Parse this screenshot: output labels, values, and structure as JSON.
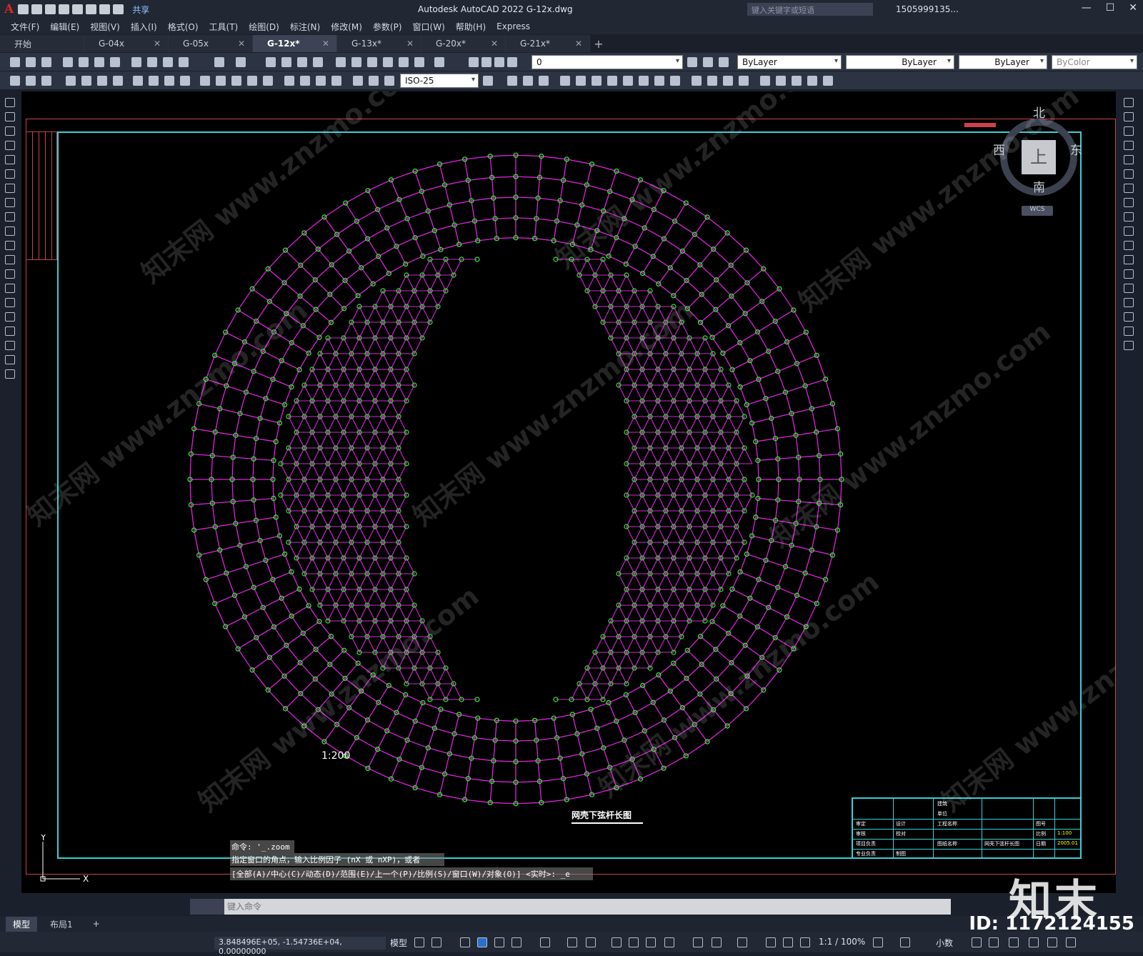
{
  "app": {
    "logo": "A",
    "share_label": "共享",
    "title": "Autodesk AutoCAD 2022    G-12x.dwg",
    "search_placeholder": "键入关键字或短语",
    "user": "1505999135...",
    "window_controls": [
      "—",
      "☐",
      "✕"
    ]
  },
  "menu": [
    "文件(F)",
    "编辑(E)",
    "视图(V)",
    "插入(I)",
    "格式(O)",
    "工具(T)",
    "绘图(D)",
    "标注(N)",
    "修改(M)",
    "参数(P)",
    "窗口(W)",
    "帮助(H)",
    "Express"
  ],
  "tabs": [
    {
      "label": "开始",
      "active": false
    },
    {
      "label": "G-04x",
      "active": false
    },
    {
      "label": "G-05x",
      "active": false
    },
    {
      "label": "G-12x*",
      "active": true
    },
    {
      "label": "G-13x*",
      "active": false
    },
    {
      "label": "G-20x*",
      "active": false
    },
    {
      "label": "G-21x*",
      "active": false
    }
  ],
  "toolbar": {
    "layer": "0",
    "color": "ByLayer",
    "linetype": "ByLayer",
    "lineweight": "ByLayer",
    "plotstyle": "ByColor",
    "dimstyle": "ISO-25"
  },
  "viewcube": {
    "north": "北",
    "south": "南",
    "west": "西",
    "east": "东",
    "face": "上",
    "wcs": "WCS"
  },
  "drawing": {
    "scale_label": "1:200",
    "title": "网壳下弦杆长图",
    "colors": {
      "members": "#e021e0",
      "nodes": "#2aee2a",
      "frame": "#39d0d6",
      "border": "#c8434b"
    }
  },
  "title_block": {
    "cells": [
      "建筑",
      "单位",
      "工程名称",
      "审定",
      "审核",
      "项目负责",
      "专业负责",
      "设计",
      "校对",
      "制图",
      "图纸名称",
      "网壳下弦杆长图",
      "图号",
      "比例",
      "日期",
      "1:100",
      "2005.01"
    ]
  },
  "command": {
    "history": [
      "命令: '_.zoom",
      "指定窗口的角点，输入比例因子 (nX 或 nXP)，或者",
      "[全部(A)/中心(C)/动态(D)/范围(E)/上一个(P)/比例(S)/窗口(W)/对象(O)] <实时>: _e"
    ],
    "placeholder": "键入命令"
  },
  "layout_tabs": [
    "模型",
    "布局1"
  ],
  "status": {
    "coords": "3.848496E+05, -1.54736E+04, 0.00000000",
    "model": "模型",
    "scale": "1:1 / 100%",
    "units": "小数"
  },
  "watermark": {
    "logo": "知末",
    "id": "ID: 1172124155",
    "text": "知末网 www.znzmo.com"
  }
}
